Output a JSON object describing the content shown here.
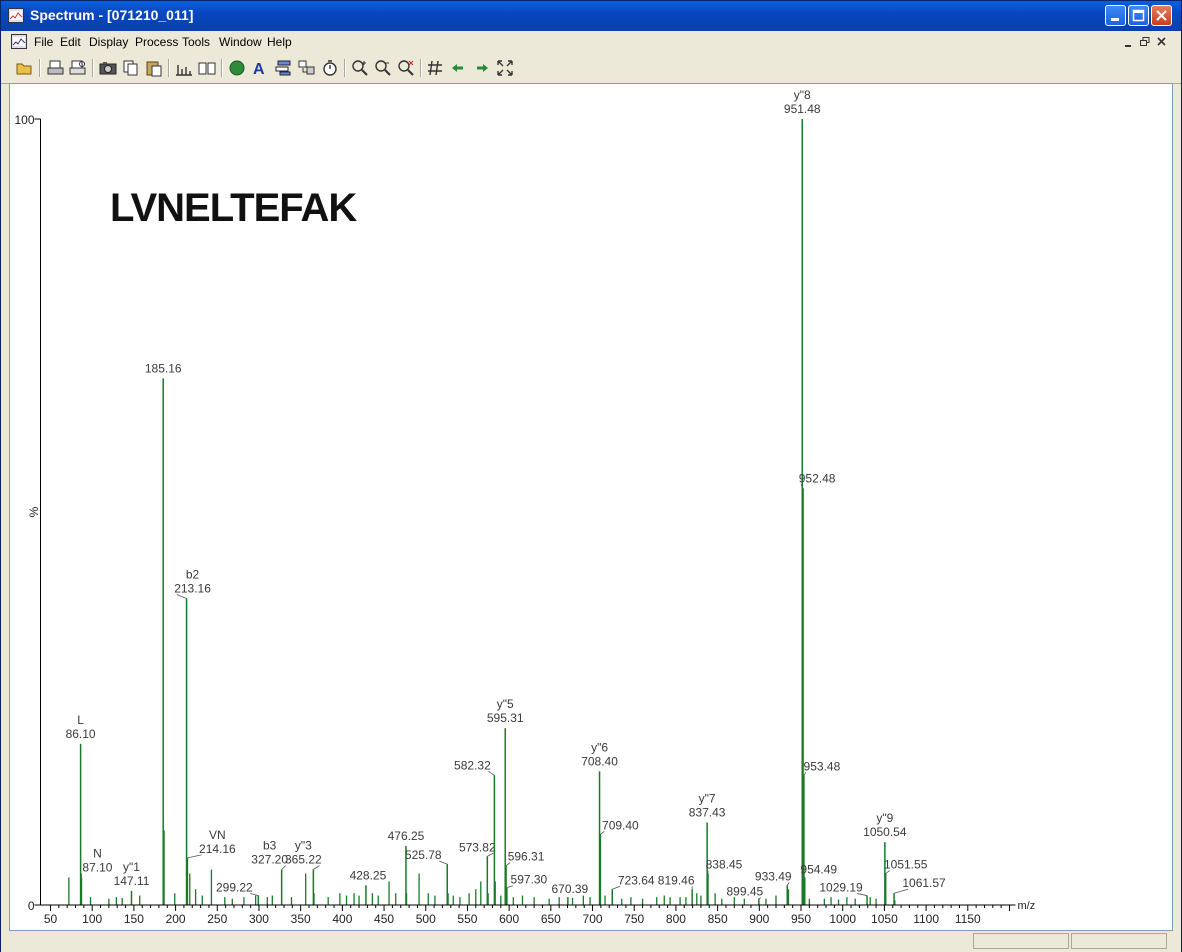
{
  "window": {
    "title": "Spectrum - [071210_011]"
  },
  "menu": [
    "File",
    "Edit",
    "Display",
    "Process",
    "Tools",
    "Window",
    "Help"
  ],
  "toolbar_icons": [
    "open-folder-icon",
    "print-icon",
    "print-preview-icon",
    "camera-icon",
    "copy-icon",
    "paste-icon",
    "bar-chart-icon",
    "book-icon",
    "green-circle-icon",
    "text-a-icon",
    "list-icon",
    "combine-icon",
    "stopwatch-icon",
    "zoom-in-icon",
    "zoom-out-icon",
    "zoom-reset-icon",
    "grid-hash-icon",
    "arrow-left-icon",
    "arrow-right-icon",
    "fit-view-icon"
  ],
  "annotation_text": "LVNELTEFAK",
  "colors": {
    "peak": "#1a7a2a",
    "axis": "#000000",
    "label": "#3a3a3a",
    "title_bar": "#0a4fd0"
  },
  "chart_data": {
    "type": "bar",
    "xlabel": "m/z",
    "ylabel": "%",
    "xlim": [
      50,
      1200
    ],
    "ylim": [
      0,
      100
    ],
    "x_ticks": [
      50,
      100,
      150,
      200,
      250,
      300,
      350,
      400,
      450,
      500,
      550,
      600,
      650,
      700,
      750,
      800,
      850,
      900,
      950,
      1000,
      1050,
      1100,
      1150
    ],
    "y_tick_labels": [
      "100",
      "0"
    ],
    "labeled_peaks": [
      {
        "mz": 86.1,
        "intensity": 20.5,
        "label": "86.10",
        "ion": "L"
      },
      {
        "mz": 87.1,
        "intensity": 3.5,
        "label": "87.10",
        "ion": "N"
      },
      {
        "mz": 147.11,
        "intensity": 1.8,
        "label": "147.11",
        "ion": "y\"1"
      },
      {
        "mz": 185.16,
        "intensity": 67,
        "label": "185.16",
        "ion": ""
      },
      {
        "mz": 213.16,
        "intensity": 39,
        "label": "213.16",
        "ion": "b2"
      },
      {
        "mz": 214.16,
        "intensity": 6,
        "label": "214.16",
        "ion": "VN"
      },
      {
        "mz": 299.22,
        "intensity": 1.2,
        "label": "299.22",
        "ion": ""
      },
      {
        "mz": 327.2,
        "intensity": 4.5,
        "label": "327.20",
        "ion": "b3"
      },
      {
        "mz": 365.22,
        "intensity": 4.5,
        "label": "365.22",
        "ion": "y\"3"
      },
      {
        "mz": 428.25,
        "intensity": 2.5,
        "label": "428.25",
        "ion": ""
      },
      {
        "mz": 476.25,
        "intensity": 7.5,
        "label": "476.25",
        "ion": ""
      },
      {
        "mz": 525.78,
        "intensity": 5.2,
        "label": "525.78",
        "ion": ""
      },
      {
        "mz": 573.82,
        "intensity": 6.2,
        "label": "573.82",
        "ion": ""
      },
      {
        "mz": 582.32,
        "intensity": 16.5,
        "label": "582.32",
        "ion": ""
      },
      {
        "mz": 595.31,
        "intensity": 22.5,
        "label": "595.31",
        "ion": "y\"5"
      },
      {
        "mz": 596.31,
        "intensity": 5,
        "label": "596.31",
        "ion": ""
      },
      {
        "mz": 597.3,
        "intensity": 2.2,
        "label": "597.30",
        "ion": ""
      },
      {
        "mz": 670.39,
        "intensity": 1,
        "label": "670.39",
        "ion": ""
      },
      {
        "mz": 708.4,
        "intensity": 17,
        "label": "708.40",
        "ion": "y\"6"
      },
      {
        "mz": 709.4,
        "intensity": 9,
        "label": "709.40",
        "ion": ""
      },
      {
        "mz": 723.64,
        "intensity": 2,
        "label": "723.64",
        "ion": ""
      },
      {
        "mz": 819.46,
        "intensity": 2,
        "label": "819.46",
        "ion": ""
      },
      {
        "mz": 837.43,
        "intensity": 10.5,
        "label": "837.43",
        "ion": "y\"7"
      },
      {
        "mz": 838.45,
        "intensity": 4,
        "label": "838.45",
        "ion": ""
      },
      {
        "mz": 899.45,
        "intensity": 0.8,
        "label": "899.45",
        "ion": ""
      },
      {
        "mz": 933.49,
        "intensity": 2.5,
        "label": "933.49",
        "ion": ""
      },
      {
        "mz": 951.48,
        "intensity": 100,
        "label": "951.48",
        "ion": "y\"8"
      },
      {
        "mz": 952.48,
        "intensity": 53,
        "label": "952.48",
        "ion": ""
      },
      {
        "mz": 953.48,
        "intensity": 16.5,
        "label": "953.48",
        "ion": ""
      },
      {
        "mz": 954.49,
        "intensity": 3.5,
        "label": "954.49",
        "ion": ""
      },
      {
        "mz": 1029.19,
        "intensity": 1.2,
        "label": "1029.19",
        "ion": ""
      },
      {
        "mz": 1050.54,
        "intensity": 8,
        "label": "1050.54",
        "ion": "y\"9"
      },
      {
        "mz": 1051.55,
        "intensity": 4,
        "label": "1051.55",
        "ion": ""
      },
      {
        "mz": 1061.57,
        "intensity": 1.5,
        "label": "1061.57",
        "ion": ""
      }
    ],
    "minor_peaks": [
      {
        "mz": 72,
        "intensity": 3.5
      },
      {
        "mz": 98,
        "intensity": 1
      },
      {
        "mz": 120,
        "intensity": 0.8
      },
      {
        "mz": 129,
        "intensity": 1
      },
      {
        "mz": 136,
        "intensity": 0.9
      },
      {
        "mz": 157,
        "intensity": 1.2
      },
      {
        "mz": 186.2,
        "intensity": 9.5
      },
      {
        "mz": 199,
        "intensity": 1.5
      },
      {
        "mz": 217,
        "intensity": 4
      },
      {
        "mz": 224,
        "intensity": 2
      },
      {
        "mz": 232,
        "intensity": 1.2
      },
      {
        "mz": 243,
        "intensity": 4.5
      },
      {
        "mz": 259,
        "intensity": 1
      },
      {
        "mz": 268,
        "intensity": 0.8
      },
      {
        "mz": 282,
        "intensity": 1
      },
      {
        "mz": 296,
        "intensity": 1.2
      },
      {
        "mz": 310,
        "intensity": 1
      },
      {
        "mz": 316,
        "intensity": 1.2
      },
      {
        "mz": 339,
        "intensity": 1
      },
      {
        "mz": 356,
        "intensity": 4
      },
      {
        "mz": 366,
        "intensity": 1.5
      },
      {
        "mz": 383,
        "intensity": 1
      },
      {
        "mz": 397,
        "intensity": 1.5
      },
      {
        "mz": 405,
        "intensity": 1.2
      },
      {
        "mz": 414,
        "intensity": 1.5
      },
      {
        "mz": 420,
        "intensity": 1.2
      },
      {
        "mz": 436,
        "intensity": 1.5
      },
      {
        "mz": 443,
        "intensity": 1.2
      },
      {
        "mz": 456,
        "intensity": 3
      },
      {
        "mz": 464,
        "intensity": 1.5
      },
      {
        "mz": 477,
        "intensity": 1.5
      },
      {
        "mz": 492,
        "intensity": 4
      },
      {
        "mz": 503,
        "intensity": 1.5
      },
      {
        "mz": 511,
        "intensity": 1.2
      },
      {
        "mz": 526.8,
        "intensity": 1.5
      },
      {
        "mz": 533,
        "intensity": 1.2
      },
      {
        "mz": 541,
        "intensity": 1
      },
      {
        "mz": 552,
        "intensity": 1.5
      },
      {
        "mz": 560,
        "intensity": 2
      },
      {
        "mz": 566,
        "intensity": 3
      },
      {
        "mz": 574.8,
        "intensity": 1.5
      },
      {
        "mz": 583.3,
        "intensity": 3
      },
      {
        "mz": 590,
        "intensity": 1.2
      },
      {
        "mz": 605,
        "intensity": 1
      },
      {
        "mz": 616,
        "intensity": 1.2
      },
      {
        "mz": 630,
        "intensity": 1
      },
      {
        "mz": 648,
        "intensity": 0.8
      },
      {
        "mz": 660,
        "intensity": 1
      },
      {
        "mz": 676,
        "intensity": 0.9
      },
      {
        "mz": 689,
        "intensity": 1.2
      },
      {
        "mz": 697,
        "intensity": 1
      },
      {
        "mz": 715,
        "intensity": 1.2
      },
      {
        "mz": 735,
        "intensity": 0.8
      },
      {
        "mz": 746,
        "intensity": 1
      },
      {
        "mz": 760,
        "intensity": 0.8
      },
      {
        "mz": 777,
        "intensity": 1
      },
      {
        "mz": 786,
        "intensity": 1.2
      },
      {
        "mz": 793,
        "intensity": 1
      },
      {
        "mz": 805,
        "intensity": 1
      },
      {
        "mz": 812,
        "intensity": 1
      },
      {
        "mz": 825,
        "intensity": 1.5
      },
      {
        "mz": 830,
        "intensity": 1.2
      },
      {
        "mz": 847,
        "intensity": 1.5
      },
      {
        "mz": 855,
        "intensity": 0.8
      },
      {
        "mz": 870,
        "intensity": 1
      },
      {
        "mz": 882,
        "intensity": 0.8
      },
      {
        "mz": 908,
        "intensity": 0.8
      },
      {
        "mz": 920,
        "intensity": 1.2
      },
      {
        "mz": 935,
        "intensity": 2
      },
      {
        "mz": 960,
        "intensity": 0.8
      },
      {
        "mz": 978,
        "intensity": 0.8
      },
      {
        "mz": 986,
        "intensity": 1
      },
      {
        "mz": 995,
        "intensity": 0.7
      },
      {
        "mz": 1005,
        "intensity": 1
      },
      {
        "mz": 1015,
        "intensity": 0.8
      },
      {
        "mz": 1033,
        "intensity": 1
      },
      {
        "mz": 1040,
        "intensity": 0.8
      },
      {
        "mz": 1062.5,
        "intensity": 0.6
      }
    ]
  }
}
